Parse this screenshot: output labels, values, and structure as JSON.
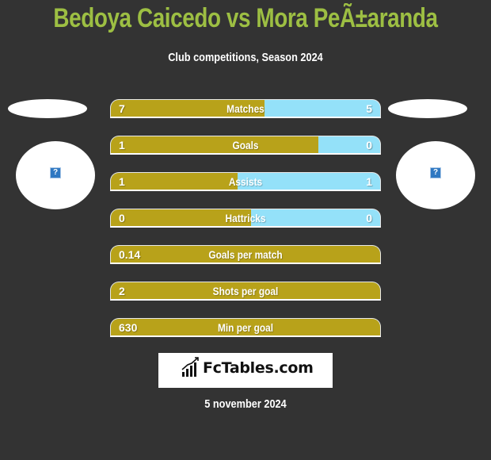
{
  "header": {
    "title": "Bedoya Caicedo vs Mora PeÃ±aranda",
    "subtitle": "Club competitions, Season 2024"
  },
  "players": {
    "left": {
      "icon": "missing-image-icon",
      "glyph": "?"
    },
    "right": {
      "icon": "missing-image-icon",
      "glyph": "?"
    }
  },
  "colors": {
    "background": "#333333",
    "title": "#9dbf43",
    "left_bar": "#b8a21a",
    "right_bar": "#94e1f9"
  },
  "stats": [
    {
      "label": "Matches",
      "left": "7",
      "right": "5",
      "left_share": 0.57
    },
    {
      "label": "Goals",
      "left": "1",
      "right": "0",
      "left_share": 0.77
    },
    {
      "label": "Assists",
      "left": "1",
      "right": "1",
      "left_share": 0.47
    },
    {
      "label": "Hattricks",
      "left": "0",
      "right": "0",
      "left_share": 0.52
    },
    {
      "label": "Goals per match",
      "left": "0.14",
      "right": "",
      "left_share": 1.0
    },
    {
      "label": "Shots per goal",
      "left": "2",
      "right": "",
      "left_share": 1.0
    },
    {
      "label": "Min per goal",
      "left": "630",
      "right": "",
      "left_share": 1.0
    }
  ],
  "footer": {
    "logo_text": "FcTables.com",
    "date": "5 november 2024"
  }
}
